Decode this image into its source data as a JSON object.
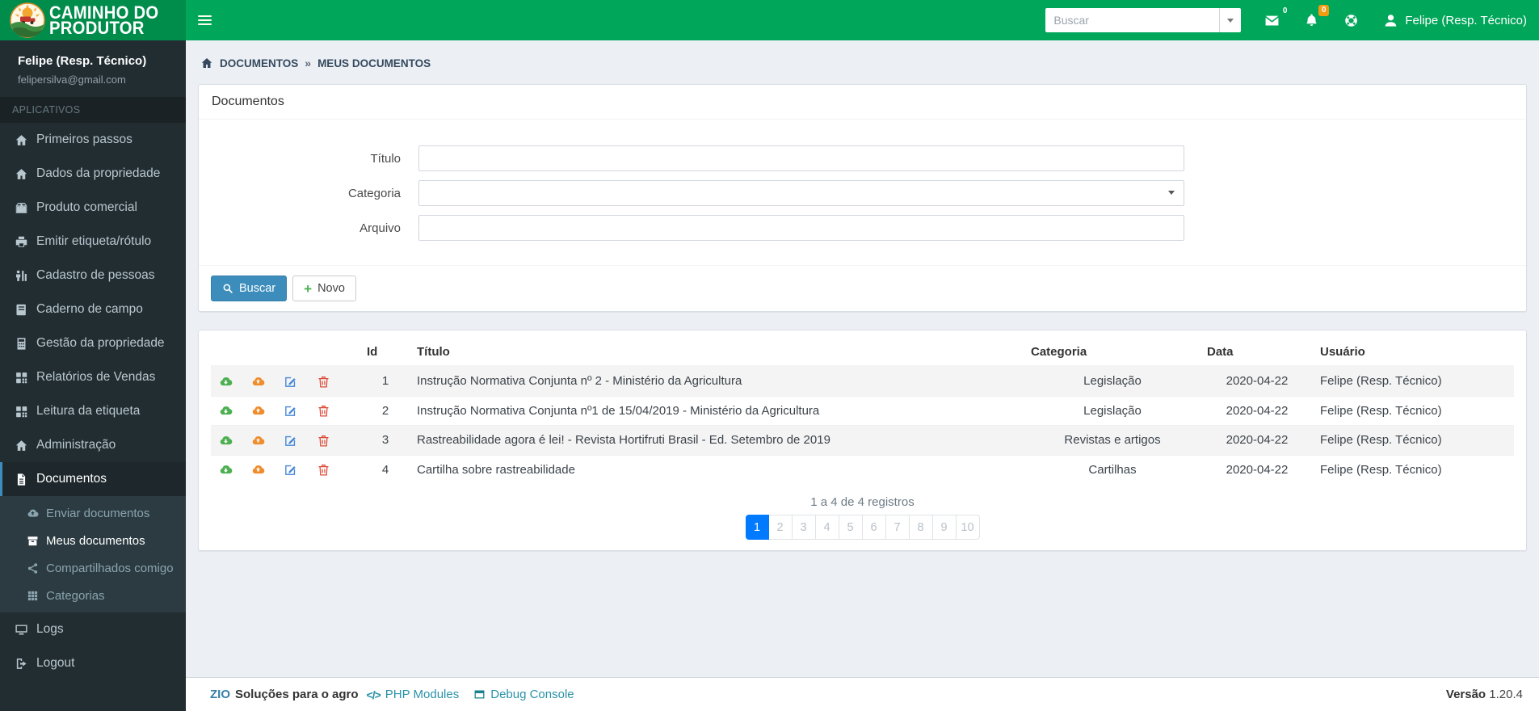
{
  "navbar": {
    "brand_line1": "CAMINHO DO",
    "brand_line2": "PRODUTOR",
    "search_placeholder": "Buscar",
    "mail_badge": "0",
    "bell_badge": "0",
    "user_name": "Felipe (Resp. Técnico)"
  },
  "sidebar": {
    "user_name": "Felipe (Resp. Técnico)",
    "user_email": "felipersilva@gmail.com",
    "section_header": "APLICATIVOS",
    "items": [
      {
        "label": "Primeiros passos",
        "icon": "home-icon"
      },
      {
        "label": "Dados da propriedade",
        "icon": "home-icon"
      },
      {
        "label": "Produto comercial",
        "icon": "box-icon"
      },
      {
        "label": "Emitir etiqueta/rótulo",
        "icon": "print-icon"
      },
      {
        "label": "Cadastro de pessoas",
        "icon": "people-icon"
      },
      {
        "label": "Caderno de campo",
        "icon": "book-icon"
      },
      {
        "label": "Gestão da propriedade",
        "icon": "calculator-icon"
      },
      {
        "label": "Relatórios de Vendas",
        "icon": "grid-icon"
      },
      {
        "label": "Leitura da etiqueta",
        "icon": "grid-icon"
      },
      {
        "label": "Administração",
        "icon": "home-icon"
      },
      {
        "label": "Documentos",
        "icon": "file-icon",
        "active": true
      }
    ],
    "submenu": [
      {
        "label": "Enviar documentos",
        "icon": "cloud-upload-icon"
      },
      {
        "label": "Meus documentos",
        "icon": "archive-icon",
        "active": true
      },
      {
        "label": "Compartilhados comigo",
        "icon": "share-icon"
      },
      {
        "label": "Categorias",
        "icon": "th-icon"
      }
    ],
    "bottom_items": [
      {
        "label": "Logs",
        "icon": "monitor-icon"
      },
      {
        "label": "Logout",
        "icon": "logout-icon"
      }
    ]
  },
  "breadcrumb": {
    "level1": "DOCUMENTOS",
    "separator": "»",
    "level2": "MEUS DOCUMENTOS"
  },
  "filter_panel": {
    "title": "Documentos",
    "fields": [
      {
        "label": "Título",
        "value": ""
      },
      {
        "label": "Categoria",
        "value": ""
      },
      {
        "label": "Arquivo",
        "value": ""
      }
    ],
    "search_button": "Buscar",
    "new_button": "Novo",
    "new_button_icon": "+"
  },
  "table": {
    "headers": {
      "id": "Id",
      "title": "Título",
      "category": "Categoria",
      "date": "Data",
      "user": "Usuário"
    },
    "rows": [
      {
        "id": "1",
        "title": "Instrução Normativa Conjunta nº 2 - Ministério da Agricultura",
        "category": "Legislação",
        "date": "2020-04-22",
        "user": "Felipe (Resp. Técnico)"
      },
      {
        "id": "2",
        "title": "Instrução Normativa Conjunta nº1 de 15/04/2019 - Ministério da Agricultura",
        "category": "Legislação",
        "date": "2020-04-22",
        "user": "Felipe (Resp. Técnico)"
      },
      {
        "id": "3",
        "title": "Rastreabilidade agora é lei! - Revista Hortifruti Brasil - Ed. Setembro de 2019",
        "category": "Revistas e artigos",
        "date": "2020-04-22",
        "user": "Felipe (Resp. Técnico)"
      },
      {
        "id": "4",
        "title": "Cartilha sobre rastreabilidade",
        "category": "Cartilhas",
        "date": "2020-04-22",
        "user": "Felipe (Resp. Técnico)"
      }
    ],
    "pagination": {
      "summary": "1 a 4 de 4 registros",
      "pages": [
        "1",
        "2",
        "3",
        "4",
        "5",
        "6",
        "7",
        "8",
        "9",
        "10"
      ],
      "active_page": "1"
    }
  },
  "footer": {
    "brand": "ZIO",
    "brand_suffix": "Soluções para o agro",
    "code_icon": "</>",
    "link1": "PHP Modules",
    "link2": "Debug Console",
    "version_label": "Versão",
    "version_value": "1.20.4"
  },
  "colors": {
    "navbar_green": "#00a65a",
    "logo_green": "#008d4c",
    "sidebar_dark": "#222d32",
    "active_border_blue": "#3c8dbc",
    "primary_button": "#3c8dbc",
    "active_page_blue": "#007bff",
    "download_green": "#4caf50",
    "upload_orange": "#ef8d2e",
    "edit_blue": "#4285d8",
    "delete_red": "#dd4b39",
    "warning_badge_orange": "#f39c12",
    "content_bg": "#ecf0f5"
  }
}
